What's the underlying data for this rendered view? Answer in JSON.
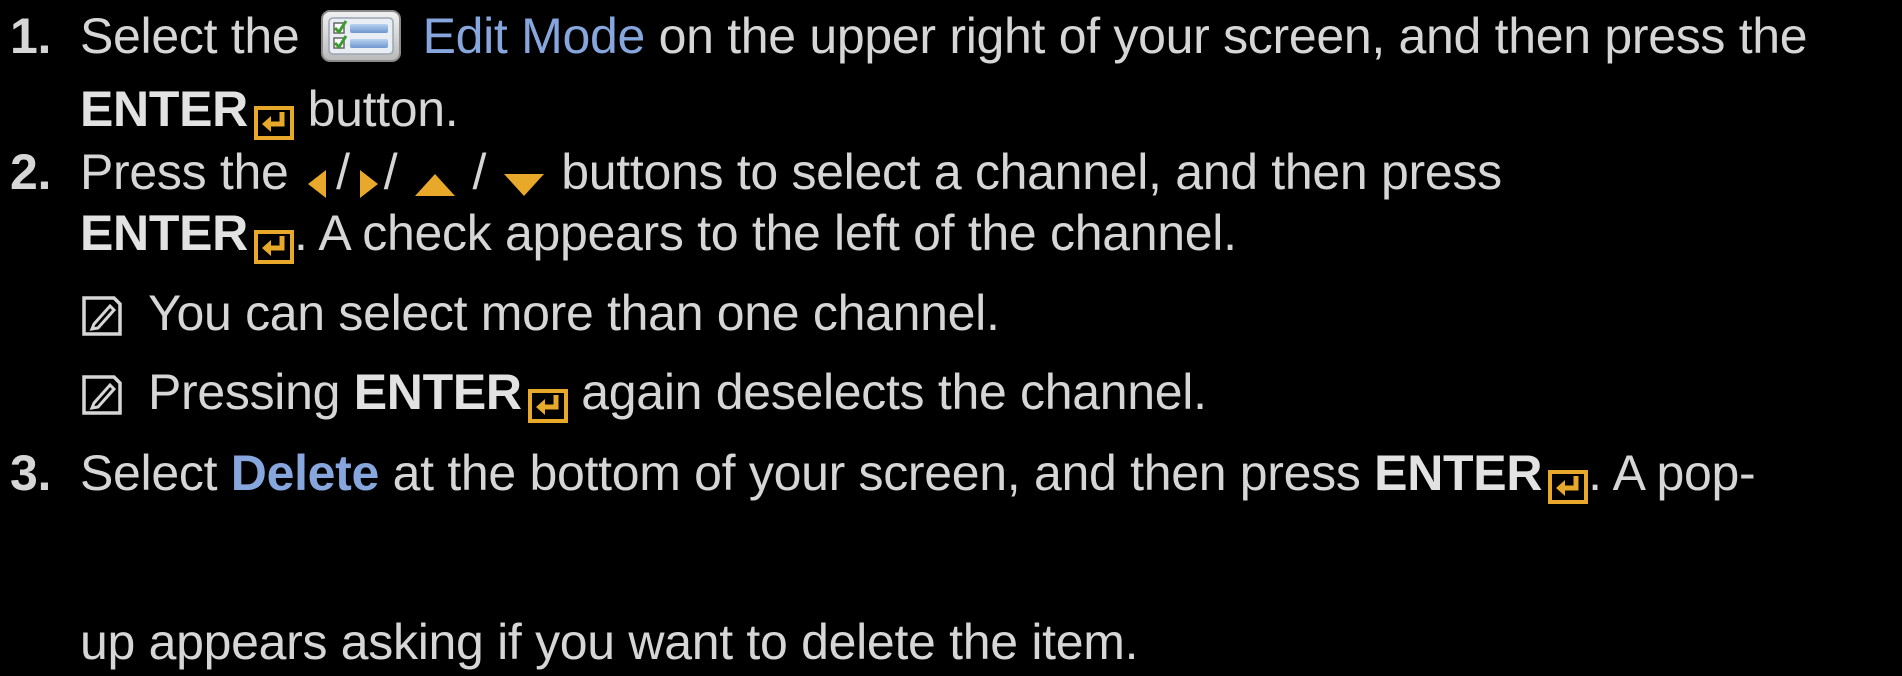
{
  "steps": [
    {
      "number": "1.",
      "line1_a": "Select the",
      "line1_highlight": "Edit Mode",
      "line1_b": "on the upper right of your screen, and then press the",
      "line2_key": "ENTER",
      "line2_b": "button."
    },
    {
      "number": "2.",
      "line1_a": "Press the",
      "line1_sep": "/",
      "line1_b": "buttons to select a channel, and then press",
      "line2_key": "ENTER",
      "line2_b": ". A check appears to the left of the channel."
    },
    {
      "number": "3.",
      "line1_a": "Select",
      "line1_highlight": "Delete",
      "line1_b": "at the bottom of your screen, and then press",
      "line1_key": "ENTER",
      "line1_c": ". A pop-",
      "line2": "up appears asking if you want to delete the item."
    }
  ],
  "notes": [
    {
      "text": "You can select more than one channel."
    },
    {
      "text_a": "Pressing",
      "key": "ENTER",
      "text_b": "again deselects the channel."
    }
  ],
  "icons": {
    "edit_mode": "edit-mode-icon",
    "enter": "enter-icon",
    "arrows": [
      "left-arrow-icon",
      "right-arrow-icon",
      "up-arrow-icon",
      "down-arrow-icon"
    ],
    "note": "note-icon"
  },
  "colors": {
    "background": "#000000",
    "text": "#d6d6d6",
    "highlight": "#86a6dd",
    "accent": "#e8a92a"
  }
}
